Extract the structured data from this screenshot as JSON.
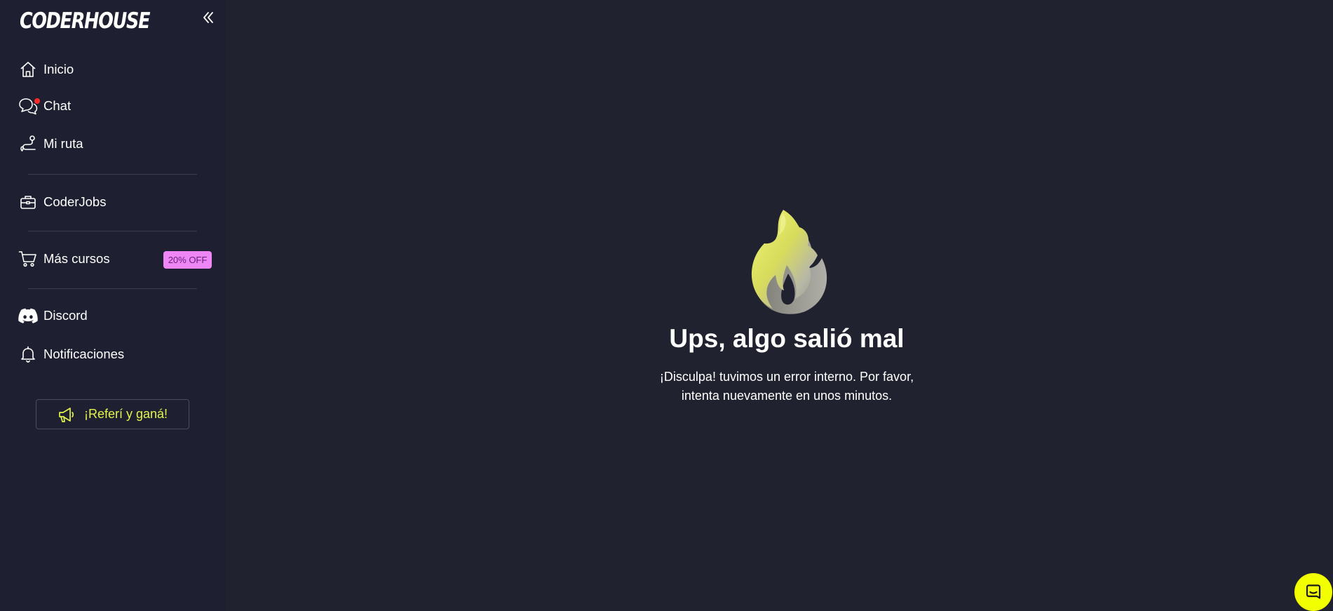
{
  "sidebar": {
    "logo": "CODERHOUSE",
    "collapse_icon": "chevrons-left-icon",
    "items": [
      {
        "label": "Inicio",
        "icon": "home-icon"
      },
      {
        "label": "Chat",
        "icon": "chat-icon",
        "has_notification_dot": true
      },
      {
        "label": "Mi ruta",
        "icon": "route-icon"
      },
      {
        "label": "CoderJobs",
        "icon": "briefcase-icon"
      },
      {
        "label": "Más cursos",
        "icon": "cart-icon",
        "badge": "20% OFF"
      },
      {
        "label": "Discord",
        "icon": "discord-icon"
      },
      {
        "label": "Notificaciones",
        "icon": "bell-icon"
      }
    ],
    "referral_button": {
      "label": "¡Referí y ganá!",
      "icon": "megaphone-icon"
    }
  },
  "error": {
    "illustration": "flame-icon",
    "title": "Ups, algo salió mal",
    "message": "¡Disculpa! tuvimos un error interno. Por favor, intenta nuevamente en unos minutos."
  },
  "chat_launcher": {
    "icon": "chat-bubble-icon"
  },
  "colors": {
    "background": "#20222f",
    "sidebar": "#1e2031",
    "accent_yellow": "#e3f34a",
    "badge_pink": "#ee86f6",
    "notification_red": "#ff2a2a",
    "launcher_yellow": "#f2ff00"
  }
}
